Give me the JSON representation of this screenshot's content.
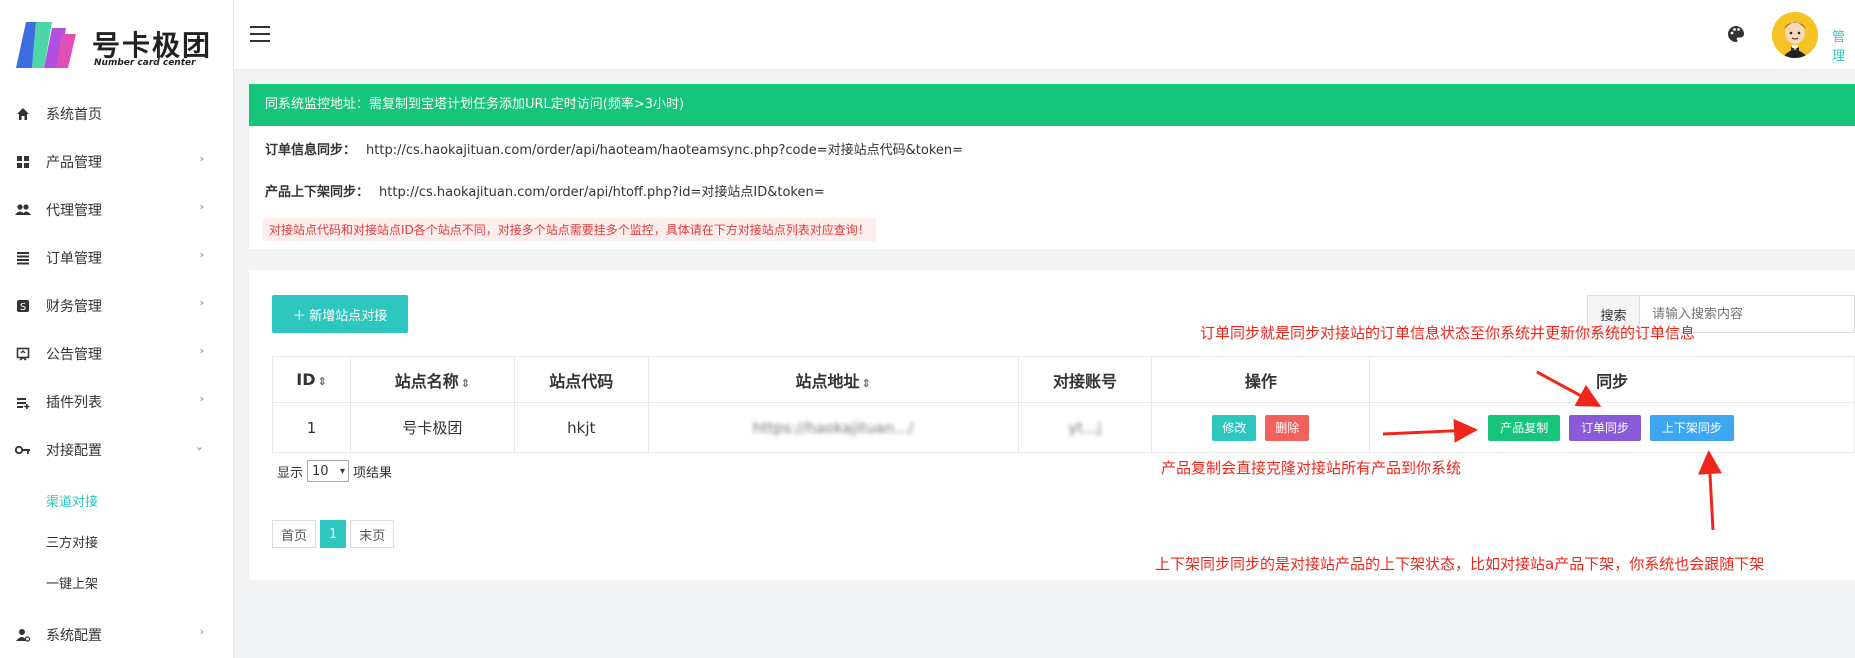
{
  "brand": {
    "title": "号卡极团",
    "subtitle": "Number card center"
  },
  "sidebar": {
    "items": [
      {
        "label": "系统首页",
        "icon": "home-icon"
      },
      {
        "label": "产品管理",
        "icon": "grid-icon"
      },
      {
        "label": "代理管理",
        "icon": "users-icon"
      },
      {
        "label": "订单管理",
        "icon": "list-icon"
      },
      {
        "label": "财务管理",
        "icon": "dollar-icon"
      },
      {
        "label": "公告管理",
        "icon": "announcement-icon"
      },
      {
        "label": "插件列表",
        "icon": "plugin-icon"
      },
      {
        "label": "对接配置",
        "icon": "key-icon"
      }
    ],
    "sub_items": [
      {
        "label": "渠道对接",
        "active": true
      },
      {
        "label": "三方对接",
        "active": false
      },
      {
        "label": "一键上架",
        "active": false
      }
    ],
    "bottom_item": {
      "label": "系统配置",
      "icon": "user-settings-icon"
    }
  },
  "header": {
    "user_label": "管理"
  },
  "monitor": {
    "banner": "同系统监控地址：需复制到宝塔计划任务添加URL定时访问(频率>3小时)",
    "order_sync_label": "订单信息同步：",
    "order_sync_url": "http://cs.haokajituan.com/order/api/haoteam/haoteamsync.php?code=对接站点代码&token=",
    "product_sync_label": "产品上下架同步：",
    "product_sync_url": "http://cs.haokajituan.com/order/api/htoff.php?id=对接站点ID&token=",
    "warning": "对接站点代码和对接站点ID各个站点不同，对接多个站点需要挂多个监控，具体请在下方对接站点列表对应查询！"
  },
  "toolbar": {
    "add_label": "＋ 新增站点对接",
    "search_label": "搜索",
    "search_placeholder": "请输入搜索内容"
  },
  "table": {
    "columns": [
      "ID",
      "站点名称",
      "站点代码",
      "站点地址",
      "对接账号",
      "操作",
      "同步"
    ],
    "rows": [
      {
        "id": "1",
        "name": "号卡极团",
        "code": "hkjt",
        "url": "https://haokajituan.../",
        "account": "yt...j"
      }
    ],
    "edit_label": "修改",
    "delete_label": "删除",
    "copy_label": "产品复制",
    "order_sync_label": "订单同步",
    "shelf_sync_label": "上下架同步"
  },
  "pagination": {
    "show_label": "显示",
    "per_page": "10",
    "result_label": "项结果",
    "first": "首页",
    "current": "1",
    "last": "末页"
  },
  "annotations": {
    "order_sync": "订单同步就是同步对接站的订单信息状态至你系统并更新你系统的订单信息",
    "product_copy": "产品复制会直接克隆对接站所有产品到你系统",
    "shelf_sync": "上下架同步同步的是对接站产品的上下架状态，比如对接站a产品下架，你系统也会跟随下架"
  },
  "colors": {
    "accent": "#2ec7c0",
    "banner": "#16c47a",
    "annotation": "#f0261a",
    "copy_button": "#16c47a",
    "order_sync_button": "#8a5bd8",
    "shelf_sync_button": "#3fa7f2",
    "edit_button": "#2ec7c0",
    "delete_button": "#f2615c"
  }
}
